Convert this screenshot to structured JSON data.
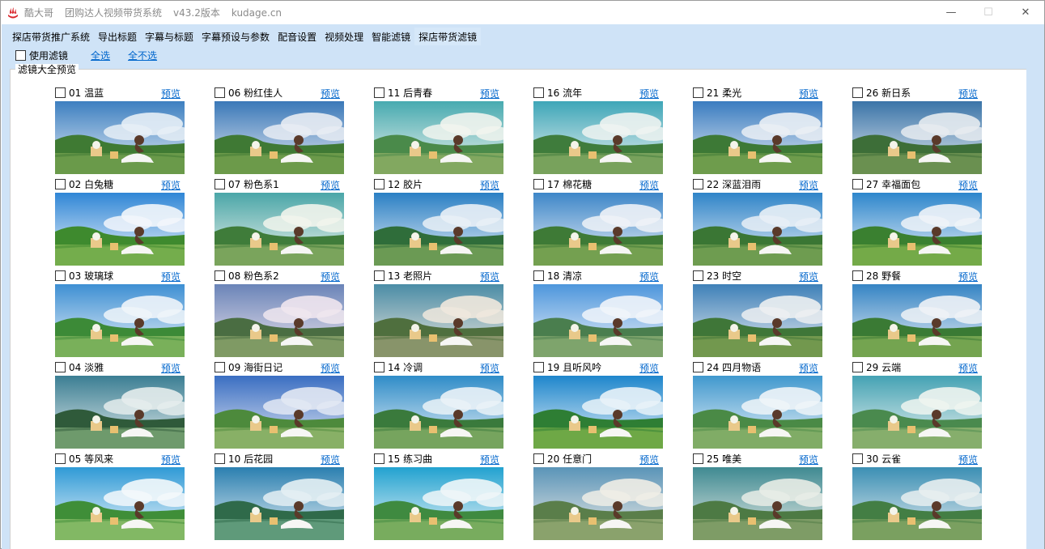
{
  "window": {
    "title_parts": [
      "酷大哥",
      "团购达人视频带货系统",
      "v43.2版本",
      "kudage.cn"
    ],
    "minimize": "—",
    "maximize": "☐",
    "close": "✕"
  },
  "tabs": [
    {
      "label": "探店带货推广系统",
      "active": false
    },
    {
      "label": "导出标题",
      "active": false
    },
    {
      "label": "字幕与标题",
      "active": false
    },
    {
      "label": "字幕预设与参数",
      "active": false
    },
    {
      "label": "配音设置",
      "active": false
    },
    {
      "label": "视频处理",
      "active": false
    },
    {
      "label": "智能滤镜",
      "active": false
    },
    {
      "label": "探店带货滤镜",
      "active": true
    }
  ],
  "toolbar": {
    "use_filter_label": "使用滤镜",
    "select_all": "全选",
    "select_none": "全不选"
  },
  "group": {
    "legend": "滤镜大全预览",
    "preview_label": "预览"
  },
  "filters": [
    {
      "name": "01 温蓝",
      "sky": "#3d7fc0",
      "cloud": "#e6eef6",
      "hill": "#3f7a33",
      "grass": "#6a9a4a"
    },
    {
      "name": "02 白兔糖",
      "sky": "#2f86d6",
      "cloud": "#f2f6fb",
      "hill": "#3e8a2e",
      "grass": "#74ad4c"
    },
    {
      "name": "03 玻璃球",
      "sky": "#3d8fd3",
      "cloud": "#eef4f9",
      "hill": "#3c8a37",
      "grass": "#79b05a"
    },
    {
      "name": "04 淡雅",
      "sky": "#3b7e93",
      "cloud": "#e4ecec",
      "hill": "#2f5a3a",
      "grass": "#6e9a6c"
    },
    {
      "name": "05 等风来",
      "sky": "#2f9ad6",
      "cloud": "#f3f8fb",
      "hill": "#3f8e38",
      "grass": "#82b864"
    },
    {
      "name": "06 粉红佳人",
      "sky": "#3a78b8",
      "cloud": "#e8ecf3",
      "hill": "#3f7934",
      "grass": "#6c9a4a"
    },
    {
      "name": "07 粉色系1",
      "sky": "#4aa6a8",
      "cloud": "#f1f4ec",
      "hill": "#3f7c3a",
      "grass": "#7aa45c"
    },
    {
      "name": "08 粉色系2",
      "sky": "#6a84b8",
      "cloud": "#efe6ee",
      "hill": "#4a6d42",
      "grass": "#7f9a64"
    },
    {
      "name": "09 海街日记",
      "sky": "#3a6ec2",
      "cloud": "#e2e8f3",
      "hill": "#4d8a3c",
      "grass": "#88b066"
    },
    {
      "name": "10 后花园",
      "sky": "#2b7fb0",
      "cloud": "#e4eff3",
      "hill": "#2f6a4a",
      "grass": "#5f9a7a"
    },
    {
      "name": "11 后青春",
      "sky": "#47aab0",
      "cloud": "#f1f4ee",
      "hill": "#4a8a4a",
      "grass": "#82a860"
    },
    {
      "name": "12 胶片",
      "sky": "#2a7fc4",
      "cloud": "#e9f0f6",
      "hill": "#2f6d3a",
      "grass": "#6b9a54"
    },
    {
      "name": "13 老照片",
      "sky": "#4a8ca6",
      "cloud": "#efe8dd",
      "hill": "#4f6f3e",
      "grass": "#88946a"
    },
    {
      "name": "14 冷调",
      "sky": "#2f8cc8",
      "cloud": "#eaf2f7",
      "hill": "#3a7a3c",
      "grass": "#76a45e"
    },
    {
      "name": "15 练习曲",
      "sky": "#22a2d0",
      "cloud": "#eef6f8",
      "hill": "#3f8a40",
      "grass": "#78ac5e"
    },
    {
      "name": "16 流年",
      "sky": "#3ea6b8",
      "cloud": "#eef3f1",
      "hill": "#3f7c3c",
      "grass": "#78a25c"
    },
    {
      "name": "17 棉花糖",
      "sky": "#3d86c8",
      "cloud": "#eef2f7",
      "hill": "#3e7a36",
      "grass": "#74a050"
    },
    {
      "name": "18 清凉",
      "sky": "#4d96dc",
      "cloud": "#f0f4fa",
      "hill": "#4a7e4e",
      "grass": "#7ea46c"
    },
    {
      "name": "19 且听风吟",
      "sky": "#1e86cc",
      "cloud": "#e8f2f8",
      "hill": "#2e7e34",
      "grass": "#6ea846"
    },
    {
      "name": "20 任意门",
      "sky": "#5a94b8",
      "cloud": "#efede6",
      "hill": "#5a7e4a",
      "grass": "#8aa26c"
    },
    {
      "name": "21 柔光",
      "sky": "#3a7cc0",
      "cloud": "#eaeff5",
      "hill": "#3d7936",
      "grass": "#6e9c4c"
    },
    {
      "name": "22 深蓝泪雨",
      "sky": "#2f84c8",
      "cloud": "#e8eff6",
      "hill": "#3a7634",
      "grass": "#6e9c50"
    },
    {
      "name": "23 时空",
      "sky": "#3e80b8",
      "cloud": "#eceff1",
      "hill": "#3f7638",
      "grass": "#72984e"
    },
    {
      "name": "24 四月物语",
      "sky": "#4098ce",
      "cloud": "#eef4f8",
      "hill": "#4a8a46",
      "grass": "#80ac66"
    },
    {
      "name": "25 唯美",
      "sky": "#3f8a92",
      "cloud": "#e8ece6",
      "hill": "#4d7a44",
      "grass": "#7e9c66"
    },
    {
      "name": "26 新日系",
      "sky": "#3a74a8",
      "cloud": "#e6ebf0",
      "hill": "#3d6e38",
      "grass": "#6a9050"
    },
    {
      "name": "27 幸福面包",
      "sky": "#2d86cc",
      "cloud": "#eef3f8",
      "hill": "#3a8030",
      "grass": "#74aa48"
    },
    {
      "name": "28 野餐",
      "sky": "#3584c4",
      "cloud": "#eef2f6",
      "hill": "#3a7a34",
      "grass": "#74a450"
    },
    {
      "name": "29 云端",
      "sky": "#44a2b4",
      "cloud": "#eef4f0",
      "hill": "#4a8a4e",
      "grass": "#86ae6c"
    },
    {
      "name": "30 云雀",
      "sky": "#3b8fb4",
      "cloud": "#e8eef0",
      "hill": "#437e44",
      "grass": "#7aa060"
    }
  ]
}
